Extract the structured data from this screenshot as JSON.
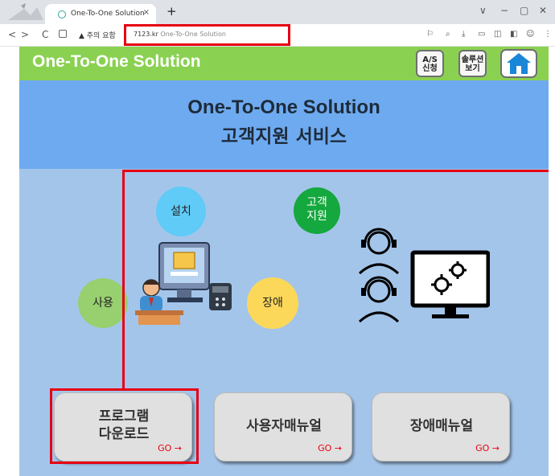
{
  "browser": {
    "tab_title": "One-To-One Solution",
    "tab_close": "×",
    "new_tab": "+",
    "window_controls": [
      "∨",
      "−",
      "▢",
      "✕"
    ],
    "nav_buttons": [
      "<",
      ">",
      "C"
    ],
    "security_warning": "▲ 주의 요함",
    "url_host": "7123.kr",
    "url_path": "One-To-One Solution"
  },
  "header": {
    "title": "One-To-One Solution",
    "as_request": [
      "A/S",
      "신청"
    ],
    "solution_view": [
      "솔루션",
      "보기"
    ]
  },
  "banner": {
    "line1": "One-To-One Solution",
    "line2": "고객지원 서비스"
  },
  "circles": {
    "install": "설치",
    "support": [
      "고객",
      "지원"
    ],
    "use": "사용",
    "fault": "장애"
  },
  "menu": [
    {
      "line1": "프로그램",
      "line2": "다운로드",
      "go": "GO →"
    },
    {
      "line1": "사용자매뉴얼",
      "go": "GO →"
    },
    {
      "line1": "장애매뉴얼",
      "go": "GO →"
    }
  ],
  "colors": {
    "header_bg": "#8ad151",
    "banner_bg": "#6eaaf0",
    "page_bg": "#a4c5ea",
    "highlight": "#e60012"
  }
}
